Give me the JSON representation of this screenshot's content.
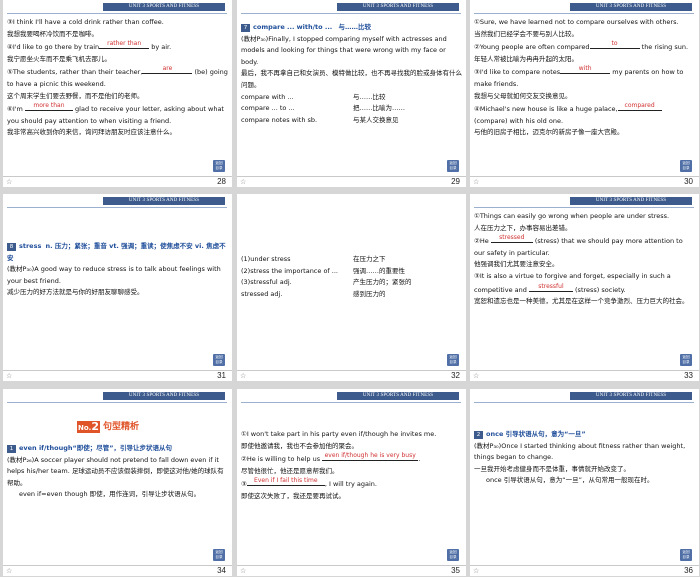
{
  "header_label": "UNIT 3   SPORTS AND FITNESS",
  "star": "☆",
  "back_button": "返回\n目录",
  "slides": [
    {
      "page": "28",
      "p1_a": "③I think I'll have a cold drink rather than coffee.",
      "p1_b": "我想我要喝杯冷饮而不是咖啡。",
      "p2_a": "④I'd like to go there by train",
      "p2_ans": "rather than",
      "p2_b": "by air.",
      "p2_c": "我宁愿坐火车而不是乘飞机去那儿。",
      "p3_a": "⑤The students, rather than their teacher,",
      "p3_ans": "are",
      "p3_b": "(be) going to have a picnic this weekend.",
      "p3_c": "这个周末学生们要去野餐，而不是他们的老师。",
      "p4_a": "⑥I'm",
      "p4_ans": "more than",
      "p4_b": "glad to receive your letter, asking about what you should pay attention to when visiting a friend.",
      "p4_c": "我非常高兴收到你的来信，询问拜访朋友时应该注意什么。"
    },
    {
      "page": "29",
      "num": "7",
      "title_en": "compare ... with/to ...",
      "title_cn": "与……比较",
      "p1": "(教材P₃₀)Finally, I stopped comparing myself with actresses and models and looking for things that were wrong with my face or body.",
      "p2": "最后，我不再拿自己和女演员、模特做比较，也不再寻找我的脸或身体有什么问题。",
      "rows": [
        {
          "en": "compare with ...",
          "cn": "与……比较"
        },
        {
          "en": "compare ... to ...",
          "cn": "把……比喻为……"
        },
        {
          "en": "compare notes with sb.",
          "cn": "与某人交换意见"
        }
      ]
    },
    {
      "page": "30",
      "p1_a": "①Sure, we have learned not to compare ourselves with others.",
      "p1_b": "当然我们已经学会不要与别人比较。",
      "p2_a": "②Young people are often compared",
      "p2_ans": "to",
      "p2_b": "the rising sun.",
      "p2_c": "年轻人常被比喻为冉冉升起的太阳。",
      "p3_a": "③I'd like to compare notes",
      "p3_ans": "with",
      "p3_b": "my parents on how to make friends.",
      "p3_c": "我想与父母就如何交友交换意见。",
      "p4_a": "④Michael's new house is like a huge palace,",
      "p4_ans": "compared",
      "p4_b": "(compare) with his old one.",
      "p4_c": "与他的旧房子相比，迈克尔的新房子像一座大宫殿。"
    },
    {
      "page": "31",
      "num": "8",
      "word": "stress",
      "def": "n. 压力；紧张；重音  vt. 强调；重读；使焦虑不安  vi. 焦虑不安",
      "p1": "(教材P₃₀)A good way to reduce stress is to talk about feelings with your best friend.",
      "p2": "减少压力的好方法就是与你的好朋友聊聊感受。"
    },
    {
      "page": "32",
      "rows": [
        {
          "en": "(1)under stress",
          "cn": "在压力之下"
        },
        {
          "en": "(2)stress the importance of ...",
          "cn": "强调……的重要性"
        },
        {
          "en": "(3)stressful adj.",
          "cn": "产生压力的；紧张的"
        },
        {
          "en": "stressed adj.",
          "cn": "感到压力的"
        }
      ]
    },
    {
      "page": "33",
      "p1_a": "①Things can easily go wrong when people are under stress.",
      "p1_b": "人在压力之下，办事容易出差错。",
      "p2_a": "②He",
      "p2_ans": "stressed",
      "p2_b": "(stress) that we should pay more attention to our safety in particular.",
      "p2_c": "他强调我们尤其要注意安全。",
      "p3_a": "③It is also a virtue to forgive and forget, especially in such a competitive and",
      "p3_ans": "stressful",
      "p3_b": "(stress) society.",
      "p3_c": "宽恕和遗忘也是一种美德，尤其是在这样一个竞争激烈、压力巨大的社会。"
    },
    {
      "page": "34",
      "banner_no": "No.",
      "banner_num": "2",
      "banner_title": "句型精析",
      "num": "1",
      "title_en": "even if/though“即使；尽管”，引导让步状语从句",
      "p1": "(教材P₂₆)A soccer player should not pretend to fall down even if it helps his/her team.",
      "p1_cn": "足球运动员不应该假装摔倒，即使这对他/她的球队有帮助。",
      "p2": "even if=even though 即使，用作连词，引导让步状语从句。"
    },
    {
      "page": "35",
      "p1_a": "①I won't take part in his party even if/though he invites me.",
      "p1_b": "即使他邀请我，我也不会参加他的聚会。",
      "p2_a": "②He is willing to help us",
      "p2_ans": "even if/though he is very busy",
      "p2_b": ".",
      "p2_c": "尽管他很忙，他还是愿意帮我们。",
      "p3_a": "③",
      "p3_ans": "Even if I fail this time",
      "p3_b": ", I will try again.",
      "p3_c": "即使这次失败了，我还是要再试试。"
    },
    {
      "page": "36",
      "num": "2",
      "title_en": "once 引导状语从句，意为“一旦”",
      "p1": "(教材P₃₀)Once I started thinking about fitness rather than weight, things began to change.",
      "p2": "一旦我开始考虑健身而不是体重，事情就开始改变了。",
      "p3": "once 引导状语从句，意为“一旦”，从句常用一般现在时。"
    }
  ]
}
